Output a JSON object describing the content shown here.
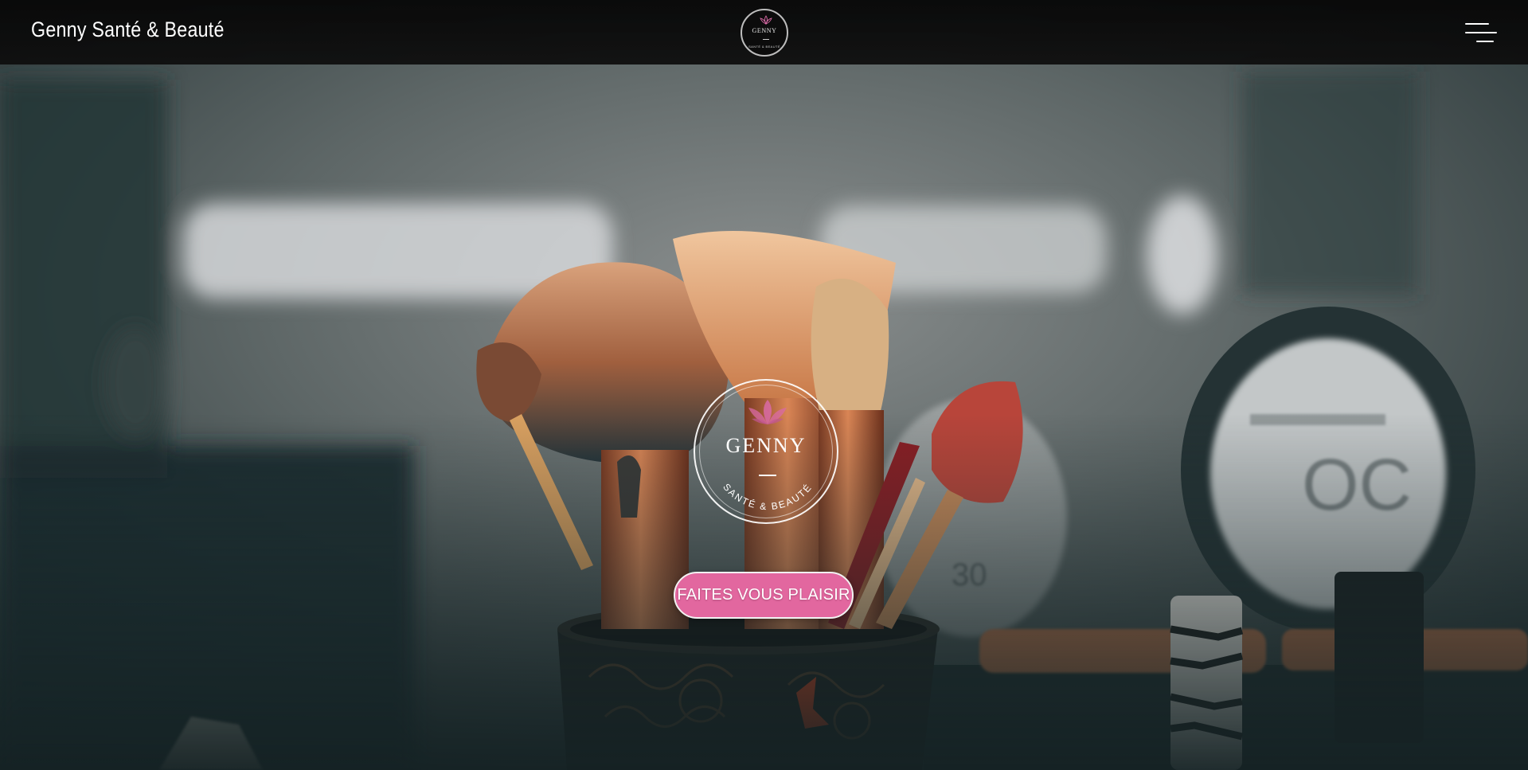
{
  "header": {
    "brand": "Genny Santé & Beauté",
    "logo": {
      "name": "GENNY",
      "subtitle": "SANTÉ & BEAUTÉ"
    },
    "menu_icon": "hamburger-menu-icon"
  },
  "hero": {
    "logo": {
      "name": "GENNY",
      "subtitle": "SANTÉ & BEAUTÉ"
    },
    "cta_label": "FAITES VOUS PLAISIR"
  },
  "colors": {
    "accent": "#e2679f",
    "header_bg": "#0b0b0b",
    "lotus_pink": "#d96aa6"
  }
}
